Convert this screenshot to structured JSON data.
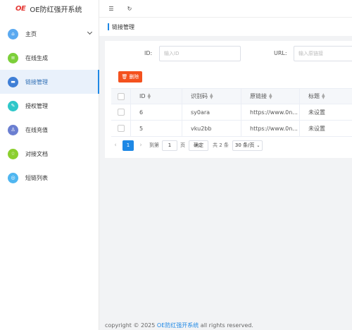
{
  "brand": {
    "logo": "OE",
    "name": "OE防红强开系统"
  },
  "sidebar": {
    "items": [
      {
        "label": "主页",
        "color": "#5aa9f0",
        "icon": "home-icon",
        "glyph": "⌂"
      },
      {
        "label": "在线生成",
        "color": "#7ccf3a",
        "icon": "layers-icon",
        "glyph": "≡"
      },
      {
        "label": "链接管理",
        "color": "#3f7fd6",
        "icon": "link-list-icon",
        "glyph": "▬"
      },
      {
        "label": "授权管理",
        "color": "#2ec7c9",
        "icon": "authorize-icon",
        "glyph": "✎"
      },
      {
        "label": "在线充值",
        "color": "#6b7fd1",
        "icon": "recharge-icon",
        "glyph": "♙"
      },
      {
        "label": "对接文档",
        "color": "#8bcf2e",
        "icon": "star-icon",
        "glyph": "☆"
      },
      {
        "label": "短链列表",
        "color": "#4fb6f0",
        "icon": "shortlink-icon",
        "glyph": "◎"
      }
    ]
  },
  "topbar": {
    "menu_icon": "☰",
    "refresh_icon": "↻"
  },
  "page": {
    "title": "链接管理"
  },
  "search": {
    "id_label": "ID:",
    "id_placeholder": "输入ID",
    "url_label": "URL:",
    "url_placeholder": "输入原链接"
  },
  "toolbar": {
    "delete_label": "删除",
    "delete_icon": "🗑"
  },
  "table": {
    "headers": [
      "ID",
      "识别码",
      "原链接",
      "标题"
    ],
    "rows": [
      {
        "id": "6",
        "code": "sy0ara",
        "url": "https://www.0n...",
        "title": "未设置"
      },
      {
        "id": "5",
        "code": "vku2bb",
        "url": "https://www.0n...",
        "title": "未设置"
      }
    ]
  },
  "pager": {
    "prev": "‹",
    "current": "1",
    "next": "›",
    "goto_label": "到第",
    "goto_value": "1",
    "page_unit": "页",
    "confirm": "确定",
    "total": "共 2 条",
    "page_size": "30 条/页"
  },
  "footer": {
    "prefix": "copyright © 2025 ",
    "link": "OE防红强开系统",
    "suffix": " all rights reserved."
  }
}
